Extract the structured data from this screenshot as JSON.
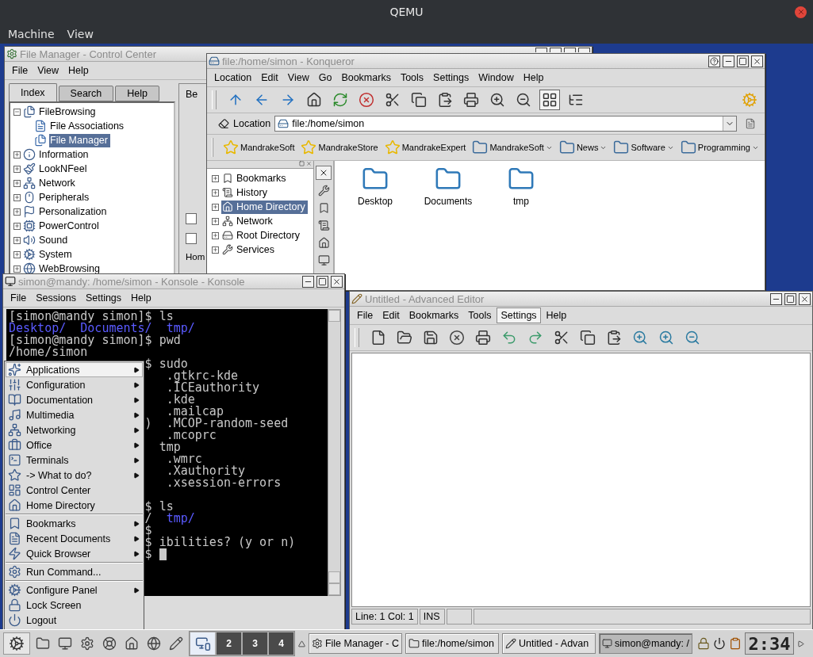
{
  "qemu": {
    "title": "QEMU",
    "menu": [
      "Machine",
      "View"
    ]
  },
  "control_center": {
    "title": "File Manager - Control Center",
    "menu": [
      "File",
      "View",
      "Help"
    ],
    "tabs": [
      {
        "label": "Index",
        "selected": true
      },
      {
        "label": "Search",
        "selected": false
      },
      {
        "label": "Help",
        "selected": false
      }
    ],
    "tree": [
      {
        "label": "FileBrowsing",
        "expanded": true,
        "selected": false,
        "children": [
          {
            "label": "File Associations",
            "selected": false
          },
          {
            "label": "File Manager",
            "selected": true
          }
        ]
      },
      {
        "label": "Information",
        "expanded": false,
        "selected": false
      },
      {
        "label": "LookNFeel",
        "expanded": false,
        "selected": false
      },
      {
        "label": "Network",
        "expanded": false,
        "selected": false
      },
      {
        "label": "Peripherals",
        "expanded": false,
        "selected": false
      },
      {
        "label": "Personalization",
        "expanded": false,
        "selected": false
      },
      {
        "label": "PowerControl",
        "expanded": false,
        "selected": false
      },
      {
        "label": "Sound",
        "expanded": false,
        "selected": false
      },
      {
        "label": "System",
        "expanded": false,
        "selected": false
      },
      {
        "label": "WebBrowsing",
        "expanded": false,
        "selected": false
      }
    ],
    "pane": {
      "tab": "Be",
      "checkboxes": [
        {
          "checked": false
        },
        {
          "checked": false
        }
      ],
      "label": "Hom"
    }
  },
  "konqueror": {
    "title": "file:/home/simon - Konqueror",
    "menu": [
      "Location",
      "Edit",
      "View",
      "Go",
      "Bookmarks",
      "Tools",
      "Settings",
      "Window",
      "Help"
    ],
    "location_label": "Location",
    "location": "file:/home/simon",
    "bookmarks": [
      {
        "label": "MandrakeSoft",
        "kind": "link"
      },
      {
        "label": "MandrakeStore",
        "kind": "link"
      },
      {
        "label": "MandrakeExpert",
        "kind": "link"
      },
      {
        "label": "MandrakeSoft",
        "kind": "folder"
      },
      {
        "label": "News",
        "kind": "folder"
      },
      {
        "label": "Software",
        "kind": "folder"
      },
      {
        "label": "Programming",
        "kind": "folder"
      }
    ],
    "sidebar": [
      {
        "label": "Bookmarks",
        "selected": false
      },
      {
        "label": "History",
        "selected": false
      },
      {
        "label": "Home Directory",
        "selected": true
      },
      {
        "label": "Network",
        "selected": false
      },
      {
        "label": "Root Directory",
        "selected": false
      },
      {
        "label": "Services",
        "selected": false
      }
    ],
    "files": [
      "Desktop",
      "Documents",
      "tmp"
    ]
  },
  "konsole": {
    "title": "simon@mandy: /home/simon - Konsole - Konsole",
    "menu": [
      "File",
      "Sessions",
      "Settings",
      "Help"
    ],
    "lines": [
      {
        "spans": [
          {
            "text": "[simon@mandy simon]$ ls",
            "kind": "plain"
          }
        ]
      },
      {
        "spans": [
          {
            "text": "Desktop/  Documents/  tmp/",
            "kind": "dir"
          }
        ]
      },
      {
        "spans": [
          {
            "text": "[simon@mandy simon]$ pwd",
            "kind": "plain"
          }
        ]
      },
      {
        "spans": [
          {
            "text": "/home/simon",
            "kind": "plain"
          }
        ]
      }
    ],
    "covered_lines": [
      {
        "spans": [
          {
            "text": "$ sudo",
            "kind": "plain"
          }
        ],
        "gap_before": false,
        "cursor": false
      },
      {
        "spans": [
          {
            "text": "   .gtkrc-kde",
            "kind": "plain"
          }
        ],
        "gap_before": false,
        "cursor": false
      },
      {
        "spans": [
          {
            "text": "   .ICEauthority",
            "kind": "plain"
          }
        ],
        "gap_before": false,
        "cursor": false
      },
      {
        "spans": [
          {
            "text": "   .kde",
            "kind": "plain"
          }
        ],
        "gap_before": false,
        "cursor": false
      },
      {
        "spans": [
          {
            "text": "   .mailcap",
            "kind": "plain"
          }
        ],
        "gap_before": false,
        "cursor": false
      },
      {
        "spans": [
          {
            "text": ")  .MCOP-random-seed",
            "kind": "plain"
          }
        ],
        "gap_before": false,
        "cursor": false
      },
      {
        "spans": [
          {
            "text": "   .mcoprc",
            "kind": "plain"
          }
        ],
        "gap_before": false,
        "cursor": false
      },
      {
        "spans": [
          {
            "text": "  tmp",
            "kind": "plain"
          }
        ],
        "gap_before": false,
        "cursor": false
      },
      {
        "spans": [
          {
            "text": "   .wmrc",
            "kind": "plain"
          }
        ],
        "gap_before": false,
        "cursor": false
      },
      {
        "spans": [
          {
            "text": "   .Xauthority",
            "kind": "plain"
          }
        ],
        "gap_before": false,
        "cursor": false
      },
      {
        "spans": [
          {
            "text": "   .xsession-errors",
            "kind": "plain"
          }
        ],
        "gap_before": false,
        "cursor": false
      },
      {
        "spans": [
          {
            "text": "$ ls",
            "kind": "plain"
          }
        ],
        "gap_before": true,
        "cursor": false
      },
      {
        "spans": [
          {
            "text": "/  ",
            "kind": "plain"
          },
          {
            "text": "tmp/",
            "kind": "dir"
          }
        ],
        "gap_before": false,
        "cursor": false
      },
      {
        "spans": [
          {
            "text": "$",
            "kind": "plain"
          }
        ],
        "gap_before": false,
        "cursor": false
      },
      {
        "spans": [
          {
            "text": "$ ibilities? (y or n)",
            "kind": "plain"
          }
        ],
        "gap_before": false,
        "cursor": false
      },
      {
        "spans": [
          {
            "text": "$ ",
            "kind": "plain"
          }
        ],
        "gap_before": false,
        "cursor": true
      }
    ]
  },
  "editor": {
    "title": "Untitled - Advanced Editor",
    "menu": [
      {
        "label": "File",
        "selected": false
      },
      {
        "label": "Edit",
        "selected": false
      },
      {
        "label": "Bookmarks",
        "selected": false
      },
      {
        "label": "Tools",
        "selected": false
      },
      {
        "label": "Settings",
        "selected": true
      },
      {
        "label": "Help",
        "selected": false
      }
    ],
    "status": [
      "Line: 1 Col: 1",
      "INS"
    ]
  },
  "k_menu": {
    "groups": [
      [
        {
          "label": "Applications",
          "submenu": true,
          "selected": true
        },
        {
          "label": "Configuration",
          "submenu": true,
          "selected": false
        },
        {
          "label": "Documentation",
          "submenu": true,
          "selected": false
        },
        {
          "label": "Multimedia",
          "submenu": true,
          "selected": false
        },
        {
          "label": "Networking",
          "submenu": true,
          "selected": false
        },
        {
          "label": "Office",
          "submenu": true,
          "selected": false
        },
        {
          "label": "Terminals",
          "submenu": true,
          "selected": false
        },
        {
          "label": "-> What to do?",
          "submenu": true,
          "selected": false
        },
        {
          "label": "Control Center",
          "submenu": false,
          "selected": false
        },
        {
          "label": "Home Directory",
          "submenu": false,
          "selected": false
        }
      ],
      [
        {
          "label": "Bookmarks",
          "submenu": true,
          "selected": false
        },
        {
          "label": "Recent Documents",
          "submenu": true,
          "selected": false
        },
        {
          "label": "Quick Browser",
          "submenu": true,
          "selected": false
        }
      ],
      [
        {
          "label": "Run Command...",
          "submenu": false,
          "selected": false
        }
      ],
      [
        {
          "label": "Configure Panel",
          "submenu": true,
          "selected": false
        },
        {
          "label": "Lock Screen",
          "submenu": false,
          "selected": false
        },
        {
          "label": "Logout",
          "submenu": false,
          "selected": false
        }
      ]
    ]
  },
  "taskbar": {
    "pager": [
      {
        "selected": true
      },
      {
        "label": "2",
        "selected": false
      },
      {
        "label": "3",
        "selected": false
      },
      {
        "label": "4",
        "selected": false
      }
    ],
    "tasks": [
      {
        "label": "File Manager - C",
        "selected": false
      },
      {
        "label": "file:/home/simon",
        "selected": false
      },
      {
        "label": "Untitled - Advan",
        "selected": false
      },
      {
        "label": "simon@mandy: /",
        "selected": true
      }
    ],
    "clock": "2:34"
  }
}
